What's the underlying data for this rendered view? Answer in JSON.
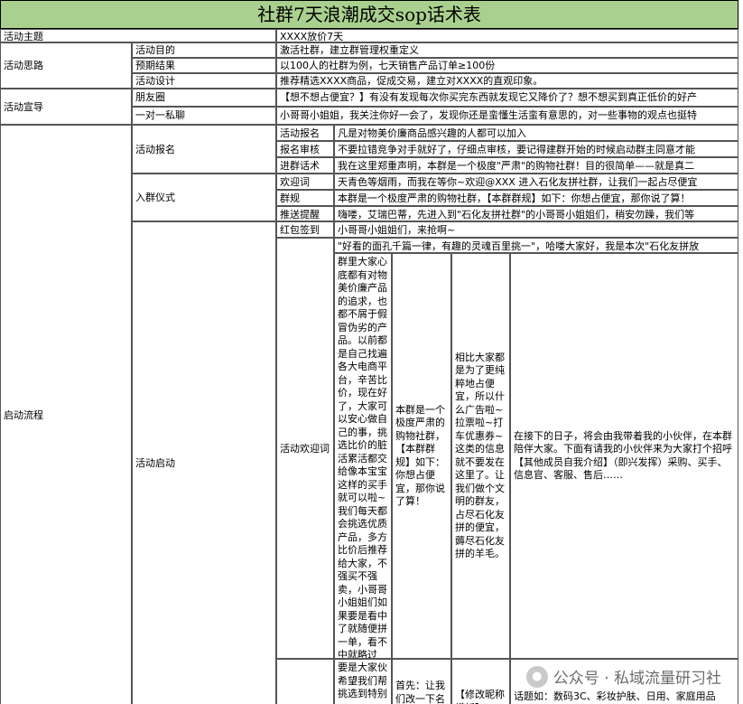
{
  "title": "社群7天浪潮成交sop话术表",
  "rows": {
    "activity_theme_label": "活动主题",
    "activity_theme_value": "XXXX放价7天",
    "activity_idea_label": "活动思路",
    "purpose_label": "活动目的",
    "purpose_value": "激活社群，建立群管理权重定义",
    "expected_label": "预期结果",
    "expected_value": "以100人的社群为例，七天销售产品订单≥100份",
    "design_label": "活动设计",
    "design_value": "推荐精选XXXX商品，促成交易，建立对XXXX的直观印象。",
    "promo_label": "活动宣导",
    "moments_label": "朋友圈",
    "moments_value": "【想不想占便宜？】有没有发现每次你买完东西就发现它又降价了？想不想买到真正低价的好产",
    "one_on_one_label": "一对一私聊",
    "one_on_one_value": "小哥哥小姐姐，我关注你好一会了，发现你还是蛮懂生活蛮有意思的，对一些事物的观点也挺特",
    "launch_label": "启动流程",
    "signup_label": "活动报名",
    "signup_sub_label": "活动报名",
    "signup_sub_value": "凡是对物美价廉商品感兴趣的人都可以加入",
    "review_label": "报名审核",
    "review_value": "不要拉错竞争对手就好了，仔细点审核，要记得建群开始的时候启动群主同意才能",
    "enter_label": "进群话术",
    "enter_value": "我在这里郑重声明，本群是一个极度\"严肃\"的购物社群！目的很简单——就是真二",
    "ceremony_label": "入群仪式",
    "welcome_label": "欢迎词",
    "welcome_value": "天青色等烟雨，而我在等你~欢迎@XXX 进入石化友拼社群，让我们一起占尽便宜",
    "rules_label": "群规",
    "rules_value": "本群是一个极度严肃的购物社群，【本群群规】如下：你想占便宜，那你说了算！",
    "push_label": "推送提醒",
    "push_value": "嗨喽，艾瑞巴蒂，先进入到\"石化友拼社群\"的小哥哥小姐姐们，稍安勿躁，我们等",
    "redpacket_label": "红包签到",
    "redpacket_value": "小哥哥小姐姐们，来抢啊~",
    "start_label": "活动启动",
    "start_intro": "\"好看的面孔千篇一律，有趣的灵魂百里挑一\"，哈喽大家好，我是本次\"石化友拼放",
    "welcome_speech_label": "活动欢迎词",
    "col_a": "群里大家心底都有对物美价廉产品的追求，也都不屑于假冒伪劣的产品。以前都是自己找遍各大电商平台，辛苦比价，现在好了，大家可以安心做自己的事，挑选比价的脏活累活都交给像本宝宝这样的买手就可以啦~我们每天都会挑选优质产品，多方比价后推荐给大家，不强买不强卖，小哥哥小姐姐们如果要是看中了就随便拼一单，看不中就略过~~",
    "col_b": "本群是一个极度严肃的购物社群，【本群群规】如下：你想占便宜，那你说了算！",
    "col_c": "相比大家都是为了更纯粹地占便宜，所以什么广告啦~拉票啦~打车优惠券~这类的信息就不要发在这里了。让我们做个文明的群友，占尽石化友拼的便宜，薅尽石化友拼的羊毛。",
    "col_d": "在接下的日子，将会由我带着我的小伙伴，在本群陪伴大家。下面有请我的小伙伴来为大家打个招呼【其他成员自我介绍】（即兴发挥）采购、买手、信息官、客服、售后……",
    "bottom_a": "要是大家伙希望我们帮挑选到特别",
    "bottom_b": "首先：让我们改一下名",
    "bottom_c": "【修改昵称模板】",
    "bottom_d": "话题如：数码3C、彩妆护肤、日用、家庭用品"
  },
  "watermark": "公众号 · 私域流量研习社",
  "colors": {
    "title_bg": "#a9d08e",
    "accent_green": "#70ad47"
  }
}
